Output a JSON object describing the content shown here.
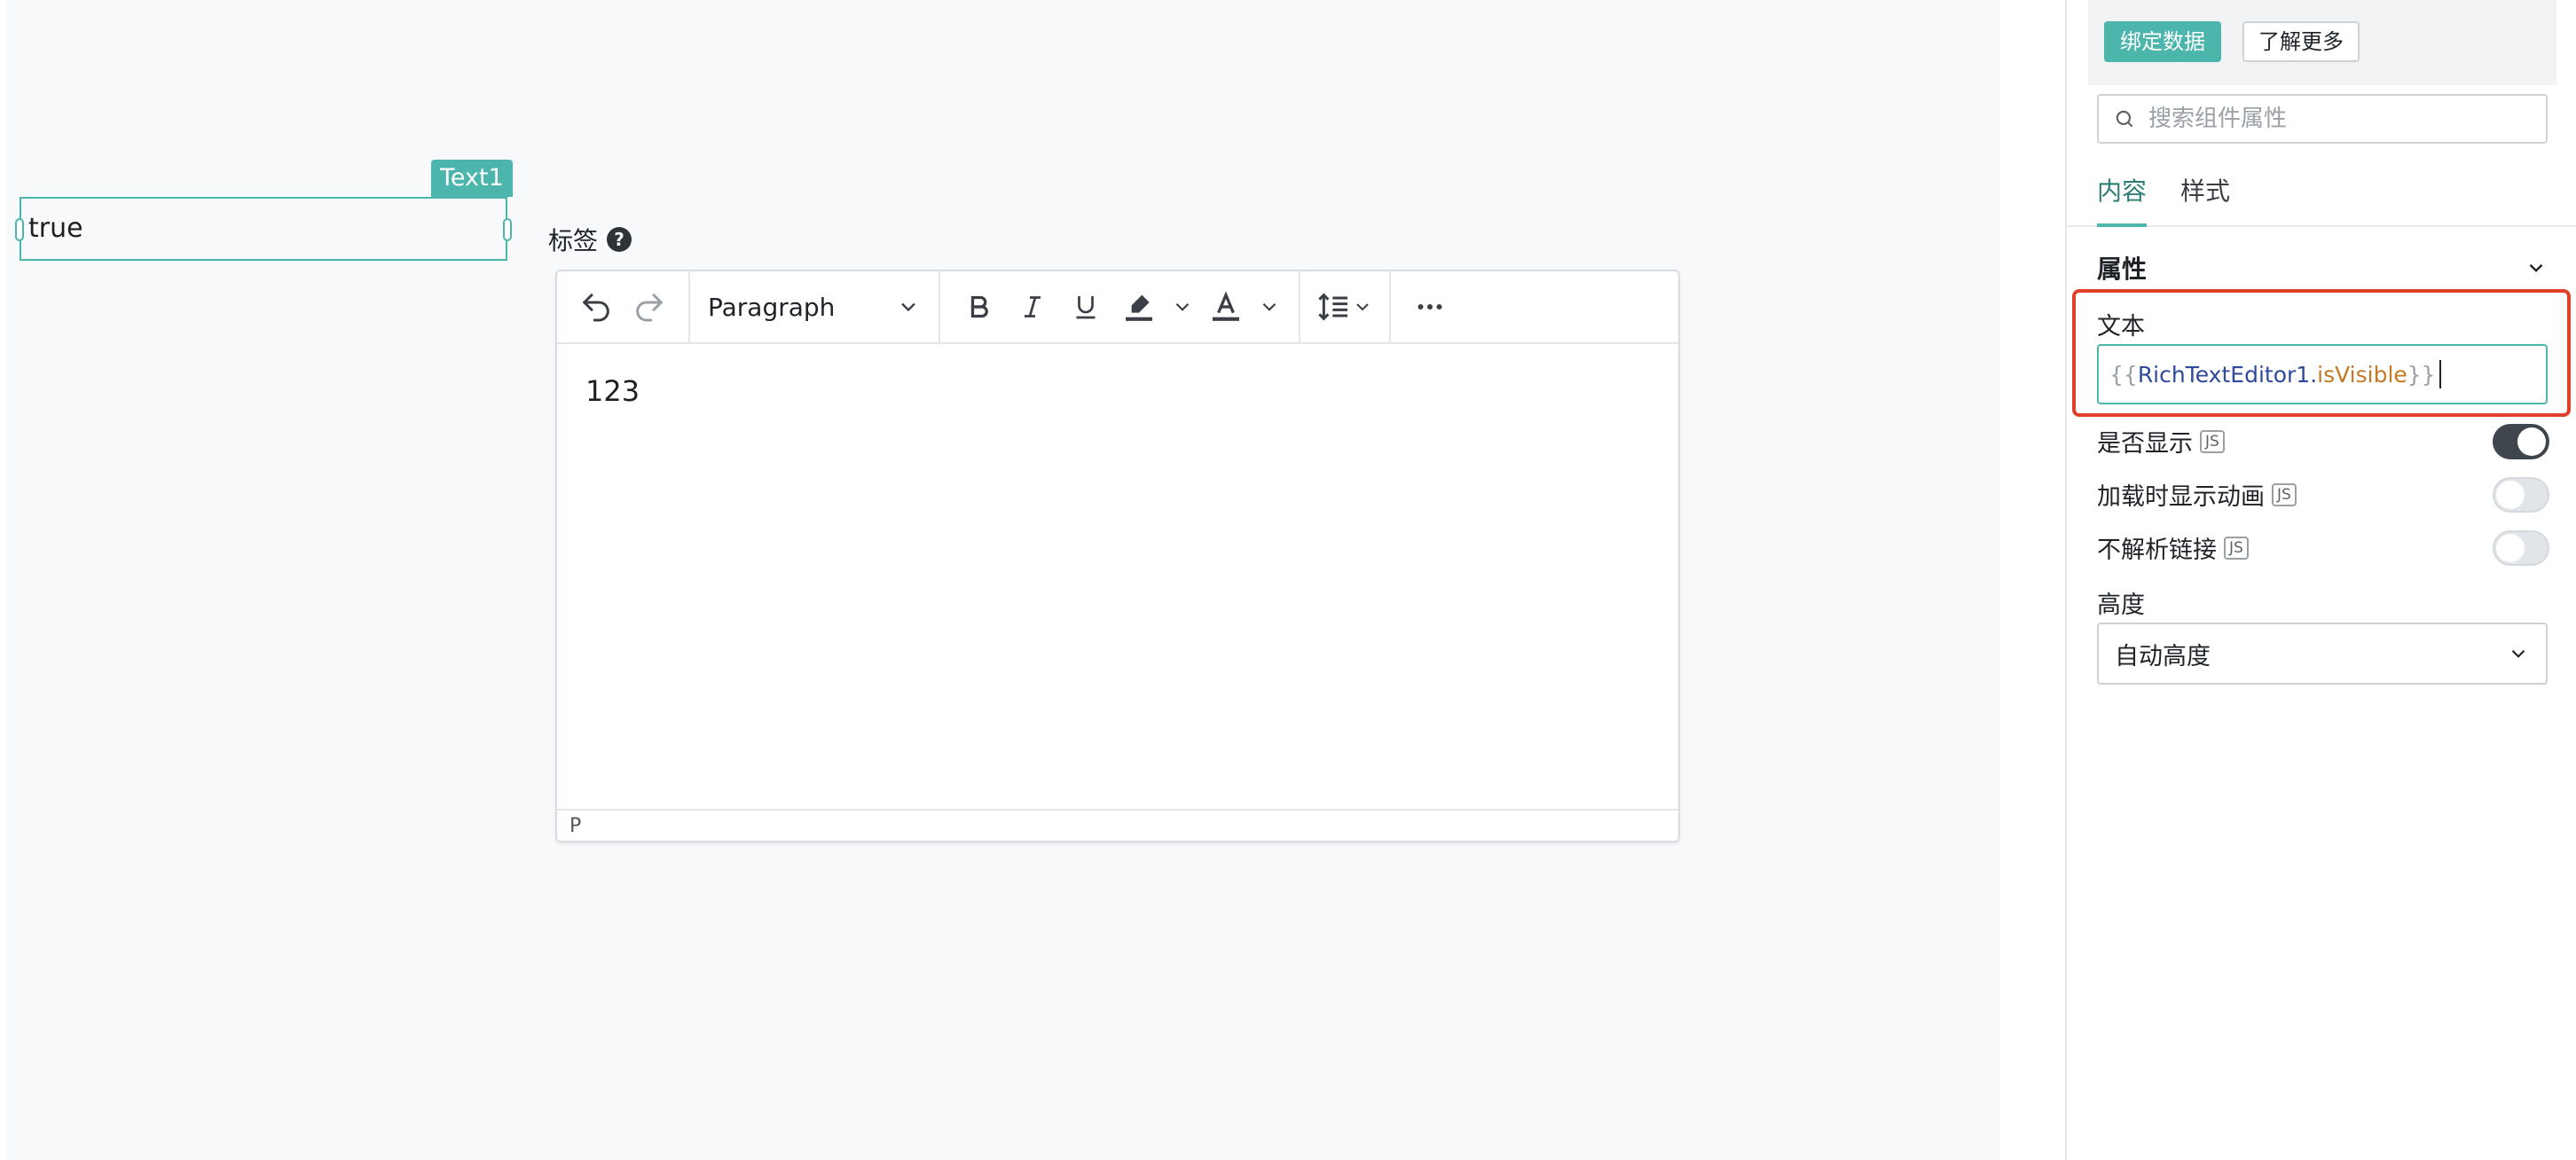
{
  "canvas": {
    "text_widget": {
      "tag": "Text1",
      "value": "true"
    },
    "rich_text_editor": {
      "label": "标签",
      "toolbar": {
        "paragraph_select": "Paragraph"
      },
      "content": "123",
      "status_path": "P"
    }
  },
  "panel": {
    "bind_button": "绑定数据",
    "learn_button": "了解更多",
    "search_placeholder": "搜索组件属性",
    "tabs": [
      "内容",
      "样式"
    ],
    "section_title": "属性",
    "text_field": {
      "label": "文本",
      "open_brace": "{{",
      "object": "RichTextEditor1",
      "dot": ".",
      "property": "isVisible",
      "close_brace": "}}"
    },
    "toggles": [
      {
        "label": "是否显示",
        "badge": "JS",
        "state": "on"
      },
      {
        "label": "加载时显示动画",
        "badge": "JS",
        "state": "off"
      },
      {
        "label": "不解析链接",
        "badge": "JS",
        "state": "off"
      }
    ],
    "height": {
      "label": "高度",
      "value": "自动高度"
    }
  },
  "colors": {
    "accent": "#4db6ac",
    "highlight": "#e0402a",
    "toggle_on": "#3f454c"
  }
}
